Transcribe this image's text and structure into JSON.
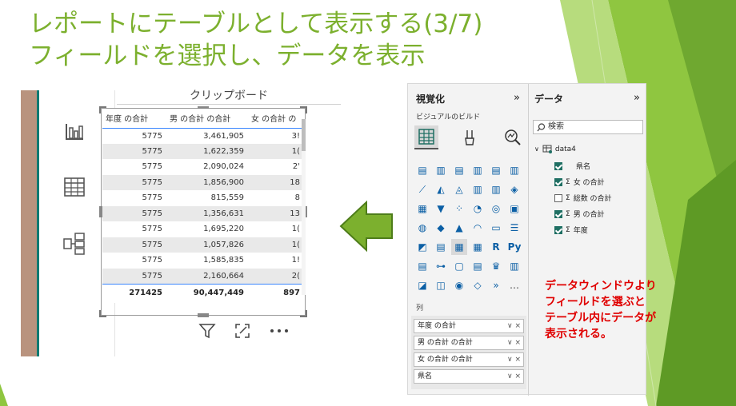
{
  "slide": {
    "title_line1": "レポートにテーブルとして表示する(3/7)",
    "title_line2": "フィールドを選択し、データを表示",
    "accent_color": "#7cb02e",
    "callout_lines": [
      "データウィンドウより",
      "フィールドを選ぶと",
      "テーブル内にデータが",
      "表示される。"
    ],
    "callout_color": "#e00000"
  },
  "left_panel": {
    "clipboard_label": "クリップボード",
    "side_icons": [
      "bar-chart-icon",
      "table-icon",
      "model-view-icon"
    ],
    "table": {
      "headers": [
        "年度 の合計",
        "男 の合計 の合計",
        "女 の合計 の"
      ],
      "rows": [
        [
          "5775",
          "3,461,905",
          "3!"
        ],
        [
          "5775",
          "1,622,359",
          "1("
        ],
        [
          "5775",
          "2,090,024",
          "2'"
        ],
        [
          "5775",
          "1,856,900",
          "18"
        ],
        [
          "5775",
          "815,559",
          "8"
        ],
        [
          "5775",
          "1,356,631",
          "13"
        ],
        [
          "5775",
          "1,695,220",
          "1("
        ],
        [
          "5775",
          "1,057,826",
          "1("
        ],
        [
          "5775",
          "1,585,835",
          "1!"
        ],
        [
          "5775",
          "2,160,664",
          "2("
        ]
      ],
      "total": [
        "271425",
        "90,447,449",
        "897"
      ]
    },
    "bottom_icons": [
      "filter-icon",
      "focus-mode-icon",
      "more-options-icon"
    ]
  },
  "right_panel": {
    "viz_pane_title": "視覚化",
    "viz_collapse": "»",
    "build_label": "ビジュアルのビルド",
    "data_pane_title": "データ",
    "data_collapse": "»",
    "search_placeholder": "検索",
    "table_name": "data4",
    "fields": [
      {
        "label": "県名",
        "checked": true,
        "sigma": false
      },
      {
        "label": "女 の合計",
        "checked": true,
        "sigma": true
      },
      {
        "label": "総数 の合計",
        "checked": false,
        "sigma": true
      },
      {
        "label": "男 の合計",
        "checked": true,
        "sigma": true
      },
      {
        "label": "年度",
        "checked": true,
        "sigma": true
      }
    ],
    "columns_label": "列",
    "wells": [
      "年度 の合計",
      "男 の合計 の合計",
      "女 の合計 の合計",
      "県名"
    ],
    "well_controls": "∨ ×",
    "more": "…"
  }
}
